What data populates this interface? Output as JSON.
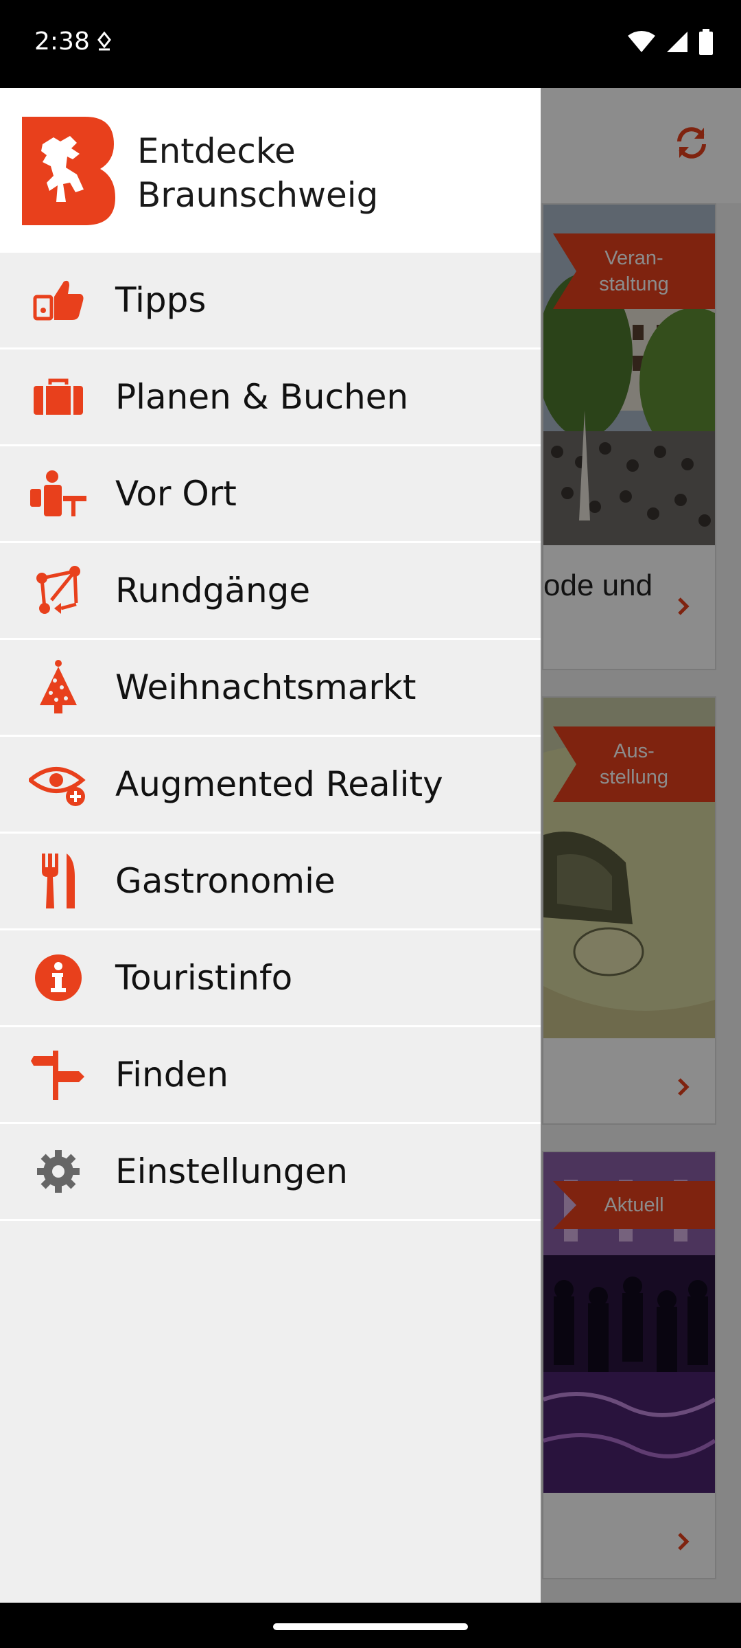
{
  "status_bar": {
    "time": "2:38"
  },
  "drawer": {
    "brand_title": "Entdecke\nBraunschweig",
    "brand_line1": "Entdecke",
    "brand_line2": "Braunschweig",
    "items": [
      {
        "label": "Tipps",
        "icon": "thumbs-up-icon"
      },
      {
        "label": "Planen & Buchen",
        "icon": "briefcase-icon"
      },
      {
        "label": "Vor Ort",
        "icon": "person-at-desk-icon"
      },
      {
        "label": "Rundgänge",
        "icon": "route-icon"
      },
      {
        "label": "Weihnachtsmarkt",
        "icon": "christmas-tree-icon"
      },
      {
        "label": "Augmented Reality",
        "icon": "eye-plus-icon"
      },
      {
        "label": "Gastronomie",
        "icon": "fork-knife-icon"
      },
      {
        "label": "Touristinfo",
        "icon": "info-icon"
      },
      {
        "label": "Finden",
        "icon": "signpost-icon"
      },
      {
        "label": "Einstellungen",
        "icon": "gear-icon"
      }
    ]
  },
  "background": {
    "cards": [
      {
        "ribbon_line1": "Veran-",
        "ribbon_line2": "staltung",
        "title_fragment": "ode und"
      },
      {
        "ribbon_line1": "Aus-",
        "ribbon_line2": "stellung",
        "title_fragment": ""
      },
      {
        "ribbon_line1": "Aktuell",
        "ribbon_line2": "",
        "title_fragment": ""
      }
    ]
  },
  "colors": {
    "accent": "#e8401c",
    "drawer_bg": "#efefef",
    "gear": "#666666"
  }
}
